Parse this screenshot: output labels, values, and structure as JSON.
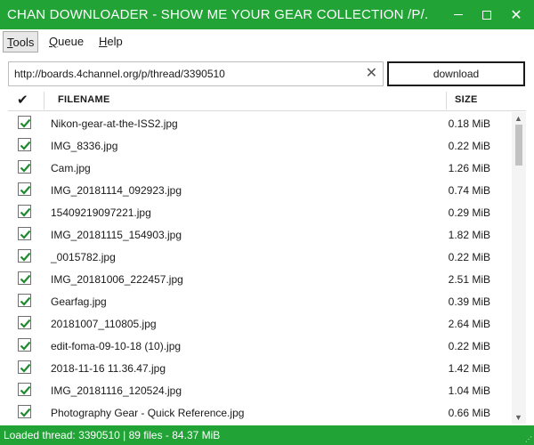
{
  "window": {
    "title": "CHAN DOWNLOADER - SHOW ME YOUR GEAR COLLECTION /P/.",
    "close_symbol": "✕"
  },
  "menu": {
    "tools_mnemonic": "T",
    "tools_rest": "ools",
    "queue_mnemonic": "Q",
    "queue_rest": "ueue",
    "help_mnemonic": "H",
    "help_rest": "elp"
  },
  "url": {
    "value": "http://boards.4channel.org/p/thread/3390510",
    "clear_symbol": "✕"
  },
  "download_label": "download",
  "columns": {
    "check_symbol": "✔",
    "filename": "FILENAME",
    "size": "SIZE"
  },
  "files": [
    {
      "name": "Nikon-gear-at-the-ISS2.jpg",
      "size": "0.18 MiB",
      "checked": true
    },
    {
      "name": "IMG_8336.jpg",
      "size": "0.22 MiB",
      "checked": true
    },
    {
      "name": "Cam.jpg",
      "size": "1.26 MiB",
      "checked": true
    },
    {
      "name": "IMG_20181114_092923.jpg",
      "size": "0.74 MiB",
      "checked": true
    },
    {
      "name": "15409219097221.jpg",
      "size": "0.29 MiB",
      "checked": true
    },
    {
      "name": "IMG_20181115_154903.jpg",
      "size": "1.82 MiB",
      "checked": true
    },
    {
      "name": "_0015782.jpg",
      "size": "0.22 MiB",
      "checked": true
    },
    {
      "name": "IMG_20181006_222457.jpg",
      "size": "2.51 MiB",
      "checked": true
    },
    {
      "name": "Gearfag.jpg",
      "size": "0.39 MiB",
      "checked": true
    },
    {
      "name": "20181007_110805.jpg",
      "size": "2.64 MiB",
      "checked": true
    },
    {
      "name": "edit-foma-09-10-18 (10).jpg",
      "size": "0.22 MiB",
      "checked": true
    },
    {
      "name": "2018-11-16 11.36.47.jpg",
      "size": "1.42 MiB",
      "checked": true
    },
    {
      "name": "IMG_20181116_120524.jpg",
      "size": "1.04 MiB",
      "checked": true
    },
    {
      "name": "Photography Gear - Quick Reference.jpg",
      "size": "0.66 MiB",
      "checked": true
    }
  ],
  "status": "Loaded thread: 3390510 | 89 files - 84.37 MiB",
  "colors": {
    "accent": "#21a336",
    "check": "#1f8a2e"
  },
  "icons": {
    "minimize": "minimize-icon",
    "maximize": "maximize-icon",
    "close": "close-icon",
    "clear": "clear-icon",
    "checkbox": "checkmark-icon",
    "scroll_up": "chevron-up-icon",
    "scroll_down": "chevron-down-icon"
  }
}
